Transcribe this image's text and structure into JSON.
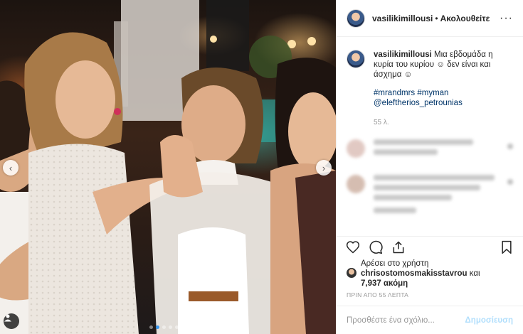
{
  "photo": {
    "alt": "",
    "nav_left": "‹",
    "nav_right": "›",
    "slide_count": 5,
    "active_slide": 1
  },
  "header": {
    "username": "vasilikimillousi",
    "separator": "•",
    "follow_label": "Ακολουθείτε",
    "more_label": "···"
  },
  "caption": {
    "username": "vasilikimillousi",
    "text": "Μια εβδομάδα η κυρία του κυρίου ☺ δεν είναι και άσχημα ☺",
    "tags": [
      "#mrandmrs",
      "#myman",
      "@eleftherios_petrounias"
    ],
    "time": "55 λ."
  },
  "icons": {
    "like": "heart-icon",
    "comment": "comment-icon",
    "share": "share-icon",
    "save": "bookmark-icon",
    "user_tag": "user-icon"
  },
  "likes": {
    "prefix": "Αρέσει στο χρήστη",
    "user": "chrisostomosmakisstavrou",
    "connector": "και",
    "count": "7,937 ακόμη"
  },
  "posted": "ΠΡΙΝ ΑΠΟ 55 ΛΕΠΤΑ",
  "comment_box": {
    "placeholder": "Προσθέστε ένα σχόλιο...",
    "publish_label": "Δημοσίευση"
  },
  "colors": {
    "link": "#003569",
    "muted": "#999999",
    "publish_disabled": "#b2dffc",
    "active_dot": "#3897f0"
  }
}
